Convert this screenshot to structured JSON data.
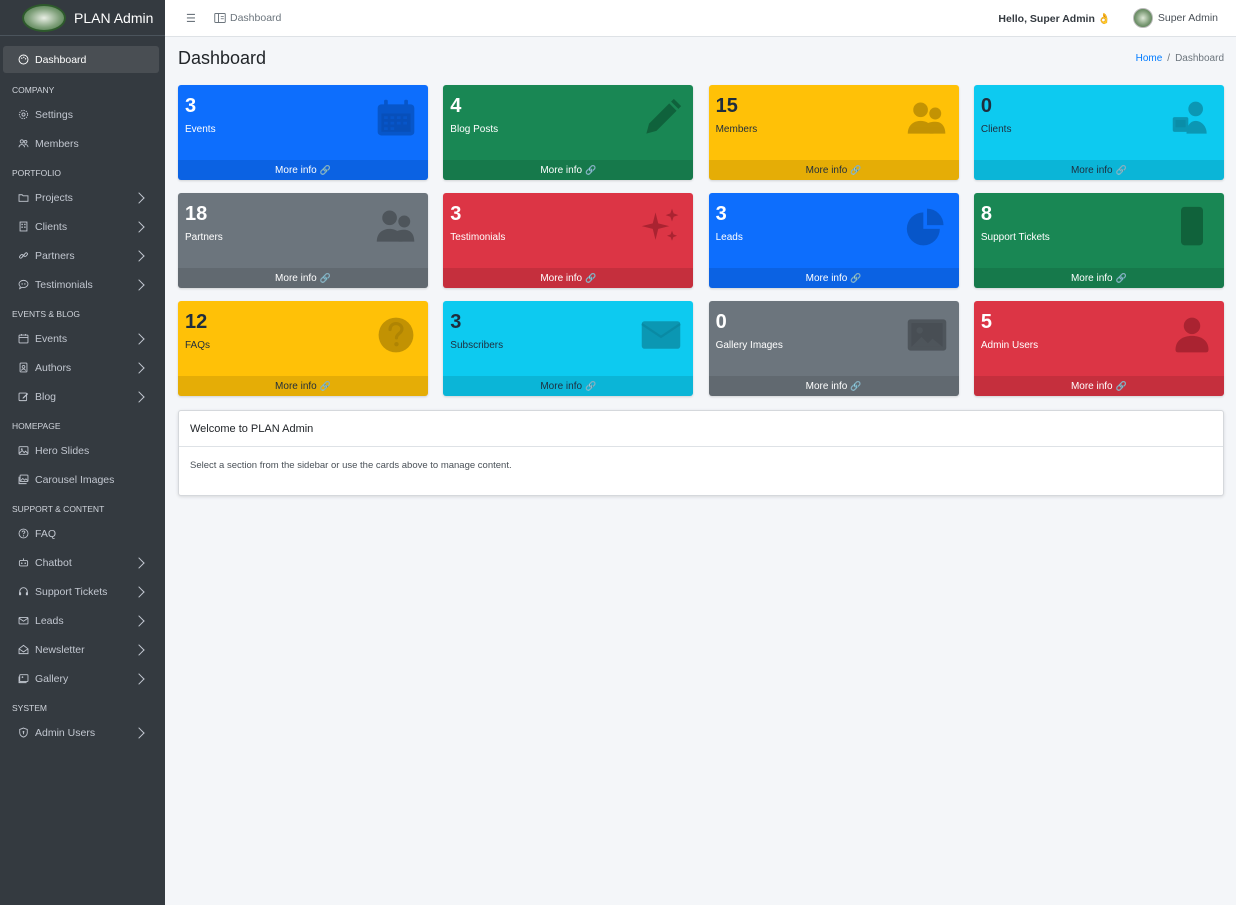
{
  "brand": {
    "name": "PLAN Admin"
  },
  "topbar": {
    "dashboard_link": "Dashboard",
    "greeting": "Hello, Super Admin 👌",
    "user_name": "Super Admin"
  },
  "sidebar": {
    "items": [
      {
        "type": "item",
        "label": "Dashboard",
        "icon": "palette-icon",
        "active": true
      },
      {
        "type": "header",
        "label": "COMPANY"
      },
      {
        "type": "item",
        "label": "Settings",
        "icon": "gear-icon"
      },
      {
        "type": "item",
        "label": "Members",
        "icon": "people-icon"
      },
      {
        "type": "header",
        "label": "PORTFOLIO"
      },
      {
        "type": "item",
        "label": "Projects",
        "icon": "folder-icon",
        "chevron": true
      },
      {
        "type": "item",
        "label": "Clients",
        "icon": "building-icon",
        "chevron": true
      },
      {
        "type": "item",
        "label": "Partners",
        "icon": "link-icon",
        "chevron": true
      },
      {
        "type": "item",
        "label": "Testimonials",
        "icon": "chat-quote-icon",
        "chevron": true
      },
      {
        "type": "header",
        "label": "EVENTS & BLOG"
      },
      {
        "type": "item",
        "label": "Events",
        "icon": "calendar-icon",
        "chevron": true
      },
      {
        "type": "item",
        "label": "Authors",
        "icon": "person-badge-icon",
        "chevron": true
      },
      {
        "type": "item",
        "label": "Blog",
        "icon": "pencil-square-icon",
        "chevron": true
      },
      {
        "type": "header",
        "label": "HOMEPAGE"
      },
      {
        "type": "item",
        "label": "Hero Slides",
        "icon": "image-icon"
      },
      {
        "type": "item",
        "label": "Carousel Images",
        "icon": "images-icon"
      },
      {
        "type": "header",
        "label": "SUPPORT & CONTENT"
      },
      {
        "type": "item",
        "label": "FAQ",
        "icon": "question-circle-icon"
      },
      {
        "type": "item",
        "label": "Chatbot",
        "icon": "robot-icon",
        "chevron": true
      },
      {
        "type": "item",
        "label": "Support Tickets",
        "icon": "headset-icon",
        "chevron": true
      },
      {
        "type": "item",
        "label": "Leads",
        "icon": "envelope-icon",
        "chevron": true
      },
      {
        "type": "item",
        "label": "Newsletter",
        "icon": "envelope-open-icon",
        "chevron": true
      },
      {
        "type": "item",
        "label": "Gallery",
        "icon": "gallery-icon",
        "chevron": true
      },
      {
        "type": "header",
        "label": "SYSTEM"
      },
      {
        "type": "item",
        "label": "Admin Users",
        "icon": "shield-icon",
        "chevron": true
      }
    ]
  },
  "header": {
    "title": "Dashboard",
    "breadcrumb": {
      "home": "Home",
      "separator": "/",
      "current": "Dashboard"
    }
  },
  "cards": [
    {
      "value": "3",
      "label": "Events",
      "color": "blue",
      "icon": "calendar-icon",
      "more": "More info"
    },
    {
      "value": "4",
      "label": "Blog Posts",
      "color": "green",
      "icon": "pencil-icon",
      "more": "More info"
    },
    {
      "value": "15",
      "label": "Members",
      "color": "yellow",
      "icon": "people-icon",
      "more": "More info"
    },
    {
      "value": "0",
      "label": "Clients",
      "color": "cyan",
      "icon": "person-workspace-icon",
      "more": "More info"
    },
    {
      "value": "18",
      "label": "Partners",
      "color": "gray",
      "icon": "people-icon",
      "more": "More info"
    },
    {
      "value": "3",
      "label": "Testimonials",
      "color": "red",
      "icon": "stars-icon",
      "more": "More info"
    },
    {
      "value": "3",
      "label": "Leads",
      "color": "blue",
      "icon": "pie-chart-icon",
      "more": "More info"
    },
    {
      "value": "8",
      "label": "Support Tickets",
      "color": "green",
      "icon": "phone-icon",
      "more": "More info"
    },
    {
      "value": "12",
      "label": "FAQs",
      "color": "yellow",
      "icon": "question-circle-icon",
      "more": "More info"
    },
    {
      "value": "3",
      "label": "Subscribers",
      "color": "cyan",
      "icon": "envelope-icon",
      "more": "More info"
    },
    {
      "value": "0",
      "label": "Gallery Images",
      "color": "gray",
      "icon": "image-icon",
      "more": "More info"
    },
    {
      "value": "5",
      "label": "Admin Users",
      "color": "red",
      "icon": "person-icon",
      "more": "More info"
    }
  ],
  "welcome": {
    "title": "Welcome to PLAN Admin",
    "body": "Select a section from the sidebar or use the cards above to manage content."
  }
}
